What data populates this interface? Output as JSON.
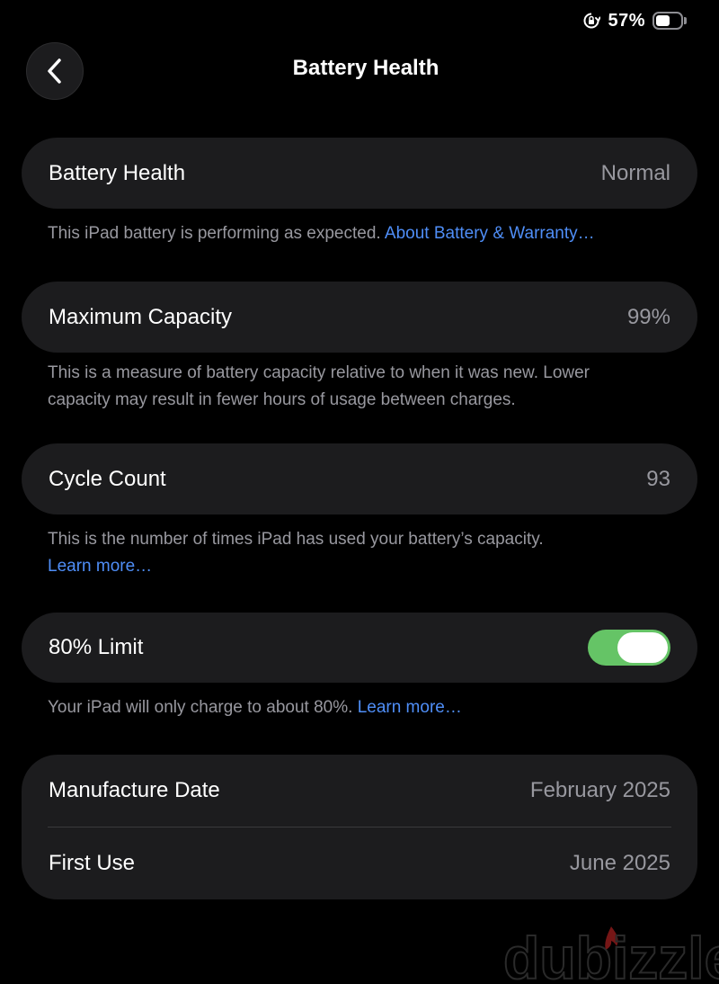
{
  "status_bar": {
    "battery_percent": "57%",
    "battery_level": 0.57
  },
  "header": {
    "title": "Battery Health",
    "back_icon": "chevron-left-icon"
  },
  "battery_health": {
    "label": "Battery Health",
    "value": "Normal",
    "note": "This iPad battery is performing as expected. ",
    "note_link": "About Battery & Warranty…"
  },
  "max_capacity": {
    "label": "Maximum Capacity",
    "value": "99%",
    "note_line1": "This is a measure of battery capacity relative to when it was new. Lower",
    "note_line2": "capacity may result in fewer hours of usage between charges."
  },
  "cycle_count": {
    "label": "Cycle Count",
    "value": "93",
    "note": "This is the number of times iPad has used your battery’s capacity.",
    "note_link": "Learn more…"
  },
  "limit": {
    "label": "80% Limit",
    "enabled": true,
    "toggle_color": "#65c466",
    "note": "Your iPad will only charge to about 80%. ",
    "note_link": "Learn more…"
  },
  "dates": {
    "manufacture_label": "Manufacture Date",
    "manufacture_value": "February 2025",
    "first_use_label": "First Use",
    "first_use_value": "June 2025"
  },
  "watermark": {
    "text": "dubizzle",
    "icon": "flame-icon"
  },
  "colors": {
    "link": "#4f8ef7",
    "card_bg": "#1c1c1e",
    "secondary_text": "#98989f"
  }
}
